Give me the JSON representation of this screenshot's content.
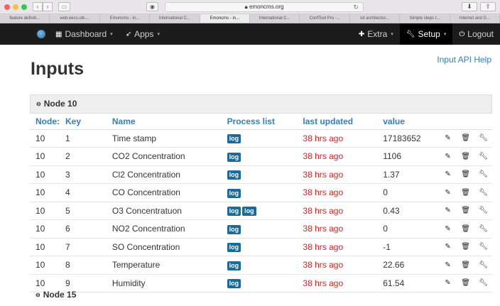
{
  "browser": {
    "url": "emoncms.org",
    "tabs": [
      "feature definiti...",
      "web.eecs.utk....",
      "Emoncms - in...",
      "International C...",
      "Emoncms - in...",
      "International C...",
      "ConfTool Pro -...",
      "iot architectur...",
      "Simple steps t...",
      "Internet and D..."
    ],
    "active_tab": 4
  },
  "nav": {
    "dashboard": "Dashboard",
    "apps": "Apps",
    "extra": "Extra",
    "setup": "Setup",
    "logout": "Logout"
  },
  "page": {
    "title": "Inputs",
    "help_link": "Input API Help"
  },
  "node_groups": [
    {
      "label": "Node 10",
      "expanded": true
    },
    {
      "label": "Node 15",
      "expanded": true
    }
  ],
  "table": {
    "headers": {
      "node": "Node:",
      "key": "Key",
      "name": "Name",
      "process": "Process list",
      "updated": "last updated",
      "value": "value"
    },
    "rows": [
      {
        "node": "10",
        "key": "1",
        "name": "Time stamp",
        "process": [
          "log"
        ],
        "updated": "38 hrs ago",
        "value": "17183652"
      },
      {
        "node": "10",
        "key": "2",
        "name": "CO2 Concentration",
        "process": [
          "log"
        ],
        "updated": "38 hrs ago",
        "value": "1106"
      },
      {
        "node": "10",
        "key": "3",
        "name": "Cl2 Concentration",
        "process": [
          "log"
        ],
        "updated": "38 hrs ago",
        "value": "1.37"
      },
      {
        "node": "10",
        "key": "4",
        "name": "CO Concentration",
        "process": [
          "log"
        ],
        "updated": "38 hrs ago",
        "value": "0"
      },
      {
        "node": "10",
        "key": "5",
        "name": "O3 Concentratuon",
        "process": [
          "log",
          "log"
        ],
        "updated": "38 hrs ago",
        "value": "0.43"
      },
      {
        "node": "10",
        "key": "6",
        "name": "NO2 Concentration",
        "process": [
          "log"
        ],
        "updated": "38 hrs ago",
        "value": "0"
      },
      {
        "node": "10",
        "key": "7",
        "name": "SO Concentration",
        "process": [
          "log"
        ],
        "updated": "38 hrs ago",
        "value": "-1"
      },
      {
        "node": "10",
        "key": "8",
        "name": "Temperature",
        "process": [
          "log"
        ],
        "updated": "38 hrs ago",
        "value": "22.66"
      },
      {
        "node": "10",
        "key": "9",
        "name": "Humidity",
        "process": [
          "log"
        ],
        "updated": "38 hrs ago",
        "value": "61.54"
      }
    ]
  },
  "icons": {
    "edit": "pencil-icon",
    "delete": "trash-icon",
    "config": "wrench-icon"
  },
  "colors": {
    "accent": "#2f7fcc",
    "updated": "#e02020",
    "badge": "#1a6b9a",
    "navbar": "#1c1c1c"
  }
}
